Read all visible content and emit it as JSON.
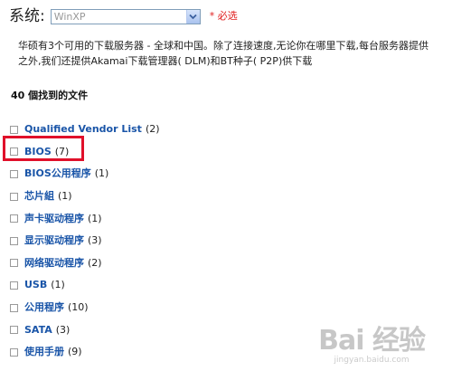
{
  "os_selector": {
    "label": "系统:",
    "selected_value": "WinXP",
    "required_mark": "* 必选"
  },
  "description": {
    "line1": "华硕有3个可用的下载服务器 - 全球和中国。除了连接速度,无论你在哪里下载,每台服务器提供",
    "line2": "之外,我们还提供Akamai下载管理器( DLM)和BT种子( P2P)供下载"
  },
  "files": {
    "heading": "40 個找到的文件",
    "items": [
      {
        "label": "Qualified Vendor List",
        "count": "(2)"
      },
      {
        "label": "BIOS",
        "count": "(7)"
      },
      {
        "label": "BIOS公用程序",
        "count": "(1)"
      },
      {
        "label": "芯片組",
        "count": "(1)"
      },
      {
        "label": "声卡驱动程序",
        "count": "(1)"
      },
      {
        "label": "显示驱动程序",
        "count": "(3)"
      },
      {
        "label": "网络驱动程序",
        "count": "(2)"
      },
      {
        "label": "USB",
        "count": "(1)"
      },
      {
        "label": "公用程序",
        "count": "(10)"
      },
      {
        "label": "SATA",
        "count": "(3)"
      },
      {
        "label": "使用手册",
        "count": "(9)"
      }
    ]
  },
  "watermark": {
    "logo": "Bai 经验",
    "url": "jingyan.baidu.com"
  },
  "colors": {
    "link": "#1a55a8",
    "required": "#e02020",
    "highlight": "#e0102a"
  }
}
